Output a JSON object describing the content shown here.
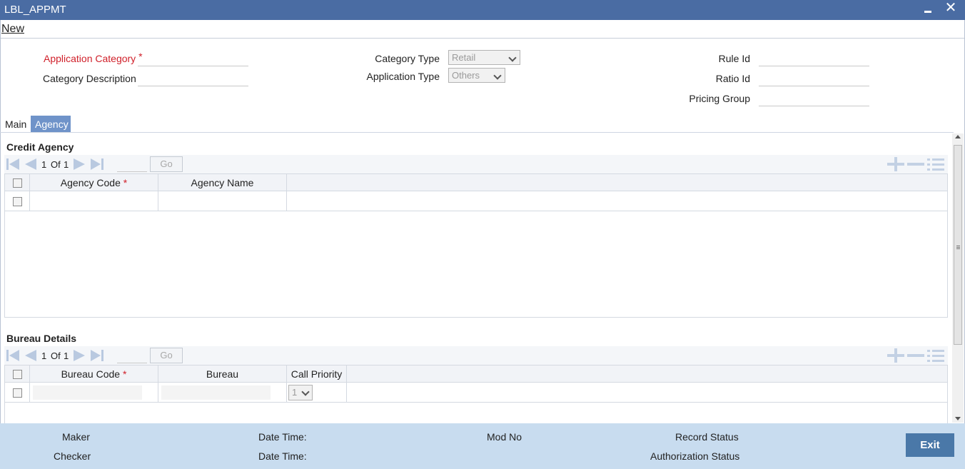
{
  "window": {
    "title": "LBL_APPMT",
    "close_glyph": "✕"
  },
  "menu": {
    "new_label": "New"
  },
  "form": {
    "application_category_label": "Application Category",
    "required_marker": "*",
    "category_description_label": "Category Description",
    "category_type_label": "Category Type",
    "category_type_value": "Retail",
    "application_type_label": "Application Type",
    "application_type_value": "Others",
    "rule_id_label": "Rule Id",
    "ratio_id_label": "Ratio Id",
    "pricing_group_label": "Pricing Group"
  },
  "tabs": [
    {
      "label": "Main",
      "active": false
    },
    {
      "label": "Agency",
      "active": true
    }
  ],
  "credit_agency": {
    "title": "Credit Agency",
    "pager": {
      "current": "1",
      "of_label": "Of",
      "total": "1",
      "go_label": "Go"
    },
    "columns": [
      "Agency Code",
      "Agency Name"
    ],
    "required_marker": "*"
  },
  "bureau_details": {
    "title": "Bureau Details",
    "pager": {
      "current": "1",
      "of_label": "Of",
      "total": "1",
      "go_label": "Go"
    },
    "columns": [
      "Bureau Code",
      "Bureau",
      "Call Priority"
    ],
    "required_marker": "*",
    "row_call_priority": "1"
  },
  "footer": {
    "maker_label": "Maker",
    "checker_label": "Checker",
    "date_time_label_1": "Date Time:",
    "date_time_label_2": "Date Time:",
    "mod_no_label": "Mod No",
    "record_status_label": "Record Status",
    "authorization_status_label": "Authorization Status",
    "exit_label": "Exit"
  },
  "colors": {
    "titlebar": "#4a6ca3",
    "active_tab": "#6f93c9",
    "footer": "#c8dcef",
    "exit_button": "#4a78a8",
    "required": "#d0202a"
  }
}
